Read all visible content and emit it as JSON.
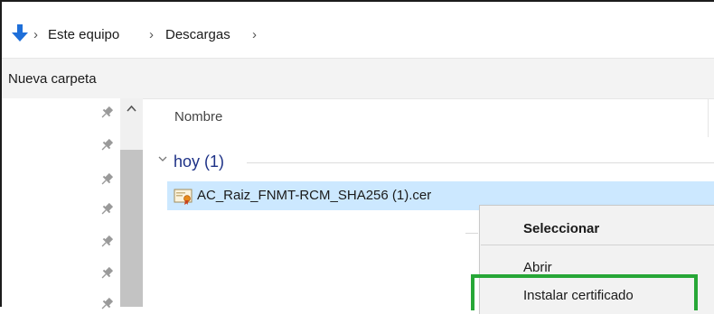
{
  "address_bar": {
    "location_icon": "download-arrow-icon",
    "crumbs": [
      "Este equipo",
      "Descargas"
    ],
    "separator": "›"
  },
  "command_bar": {
    "new_folder_label": "Nueva carpeta"
  },
  "nav_pane": {
    "pin_icon": "pin-icon",
    "pin_count": 7
  },
  "file_list": {
    "column_name": "Nombre",
    "group": {
      "label": "hoy (1)"
    },
    "files": [
      {
        "name": "AC_Raiz_FNMT-RCM_SHA256 (1).cer",
        "icon": "certificate-file-icon",
        "selected": true
      }
    ]
  },
  "context_menu": {
    "items": [
      {
        "label": "Seleccionar",
        "bold": true
      },
      {
        "label": "Abrir",
        "bold": false
      },
      {
        "label": "Instalar certificado",
        "bold": false,
        "highlighted": true
      }
    ]
  },
  "colors": {
    "selection": "#cce8ff",
    "group_title": "#1e3287",
    "highlight": "#27a737",
    "download_arrow": "#1e6fd9"
  }
}
